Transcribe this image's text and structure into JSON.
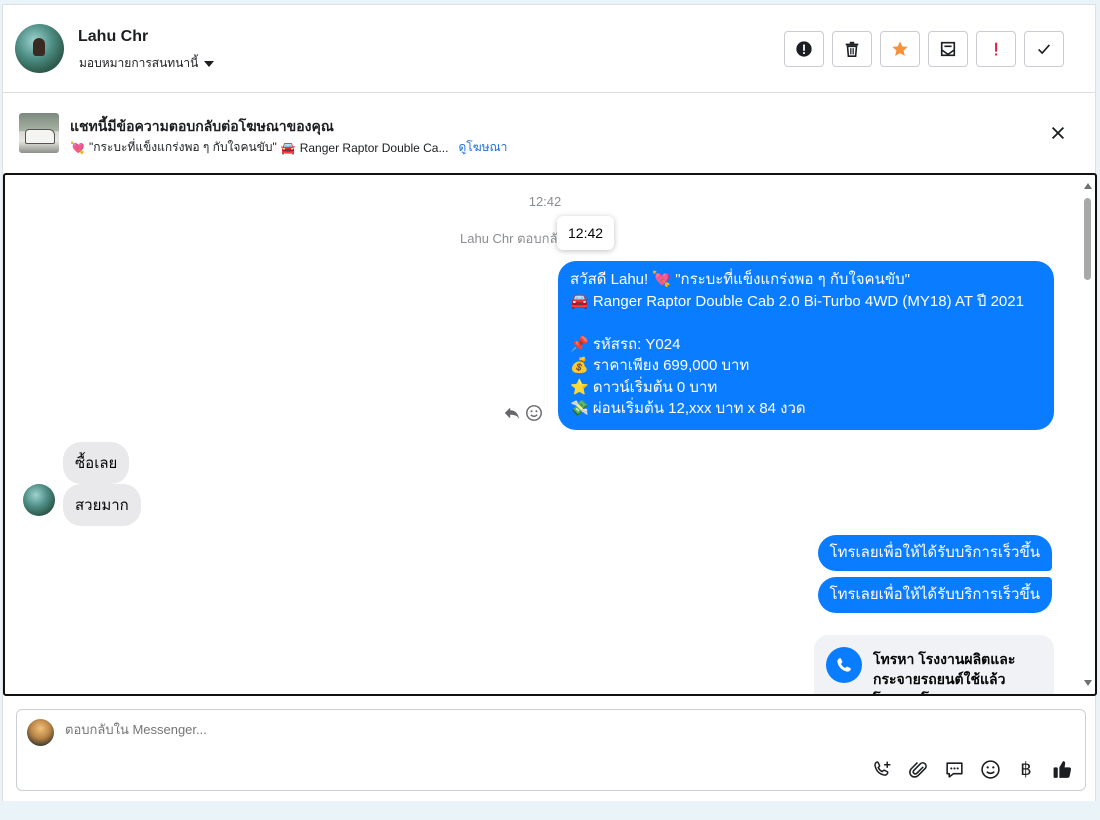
{
  "header": {
    "name": "Lahu Chr",
    "assign_label": "มอบหมายการสนทนานี้",
    "tools": [
      "spam-icon",
      "trash-icon",
      "star-icon",
      "mail-icon",
      "exclamation-icon",
      "check-icon"
    ]
  },
  "ad": {
    "title": "แชทนี้มีข้อความตอบกลับต่อโฆษณาของคุณ",
    "emoji_heart": "💘",
    "quote": "\"กระบะที่แข็งแกร่งพอ ๆ กับใจคนขับ\"",
    "emoji_car": "🚘",
    "model": "Ranger Raptor Double Ca...",
    "view_link": "ดูโฆษณา"
  },
  "chat": {
    "timestamp": "12:42",
    "reply_note": "Lahu Chr ตอบกลั",
    "tooltip": "12:42",
    "ad_message": [
      "สวัสดี Lahu! 💘 \"กระบะที่แข็งแกร่งพอ ๆ กับใจคนขับ\"",
      "🚘 Ranger Raptor Double Cab 2.0 Bi-Turbo 4WD (MY18) AT ปี 2021",
      "📌 รหัสรถ: Y024",
      "💰 ราคาเพียง 699,000 บาท",
      "⭐ ดาวน์เริ่มต้น 0 บาท",
      "💸 ผ่อนเริ่มต้น 12,xxx บาท x 84 งวด"
    ],
    "incoming": [
      "ซื้อเลย",
      "สวยมาก"
    ],
    "outgoing": [
      "โทรเลยเพื่อให้ได้รับบริการเร็วขึ้น",
      "โทรเลยเพื่อให้ได้รับบริการเร็วขึ้น"
    ],
    "call_card_text": "โทรหา โรงงานผลิตและกระจายรถยนต์ใช้แล้ว โดยตรงโดย"
  },
  "composer": {
    "placeholder": "ตอบกลับใน Messenger...",
    "icons": [
      "phone-add-icon",
      "attach-icon",
      "chat-bubble-icon",
      "emoji-icon",
      "baht-icon",
      "like-icon"
    ],
    "baht_symbol": "฿"
  },
  "colors": {
    "accent": "#0a7cff",
    "link": "#216fdb",
    "star": "#f7923b",
    "warn": "#e41e3f"
  }
}
